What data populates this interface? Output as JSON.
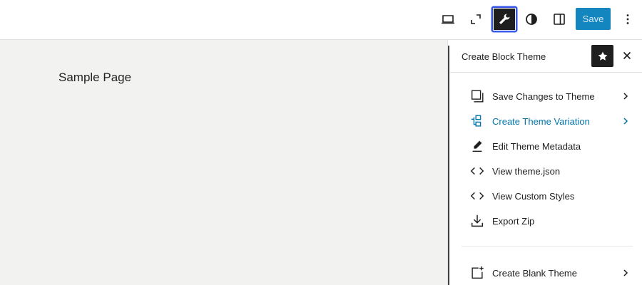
{
  "toolbar": {
    "save_label": "Save"
  },
  "canvas": {
    "page_title": "Sample Page"
  },
  "panel": {
    "title": "Create Block Theme",
    "items": [
      {
        "label": "Save Changes to Theme",
        "icon": "copy-icon",
        "chevron": true,
        "highlight": false
      },
      {
        "label": "Create Theme Variation",
        "icon": "variation-icon",
        "chevron": true,
        "highlight": true
      },
      {
        "label": "Edit Theme Metadata",
        "icon": "pencil-icon",
        "chevron": false,
        "highlight": false
      },
      {
        "label": "View theme.json",
        "icon": "code-icon",
        "chevron": false,
        "highlight": false
      },
      {
        "label": "View Custom Styles",
        "icon": "code-icon",
        "chevron": false,
        "highlight": false
      },
      {
        "label": "Export Zip",
        "icon": "download-icon",
        "chevron": false,
        "highlight": false
      },
      {
        "label": "Create Blank Theme",
        "icon": "add-template-icon",
        "chevron": true,
        "highlight": false
      }
    ]
  },
  "colors": {
    "accent": "#007cba",
    "highlight_text": "#0073aa",
    "canvas_bg": "#f2f2f0"
  }
}
